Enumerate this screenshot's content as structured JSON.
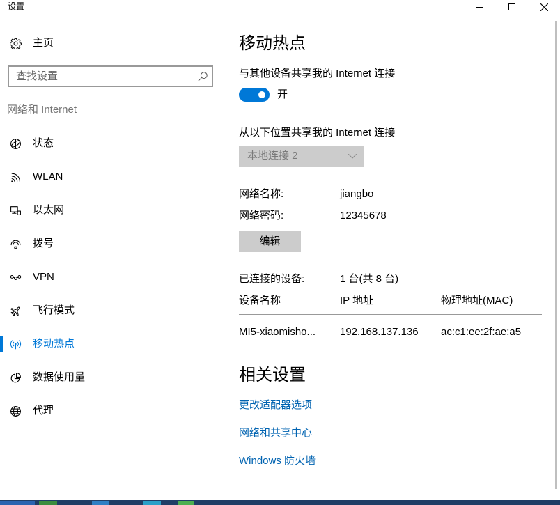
{
  "window": {
    "title": "设置",
    "controls": {
      "minimize_icon": "minimize-icon",
      "maximize_icon": "maximize-icon",
      "close_icon": "close-icon"
    }
  },
  "colors": {
    "accent": "#0078d7",
    "link": "#0063b1",
    "text": "#000000",
    "muted": "#767676",
    "disabled_fill": "#cccccc",
    "disabled_text": "#7a7a7a"
  },
  "sidebar": {
    "home": {
      "label": "主页",
      "icon": "gear-icon"
    },
    "search": {
      "placeholder": "查找设置",
      "value": "",
      "icon": "search-icon"
    },
    "section_title": "网络和 Internet",
    "items": [
      {
        "label": "状态",
        "icon": "network-status-icon",
        "selected": false
      },
      {
        "label": "WLAN",
        "icon": "wifi-icon",
        "selected": false
      },
      {
        "label": "以太网",
        "icon": "ethernet-icon",
        "selected": false
      },
      {
        "label": "拨号",
        "icon": "dial-up-icon",
        "selected": false
      },
      {
        "label": "VPN",
        "icon": "vpn-icon",
        "selected": false
      },
      {
        "label": "飞行模式",
        "icon": "airplane-icon",
        "selected": false
      },
      {
        "label": "移动热点",
        "icon": "mobile-hotspot-icon",
        "selected": true
      },
      {
        "label": "数据使用量",
        "icon": "data-usage-icon",
        "selected": false
      },
      {
        "label": "代理",
        "icon": "proxy-globe-icon",
        "selected": false
      }
    ]
  },
  "main": {
    "title": "移动热点",
    "share_label": "与其他设备共享我的 Internet 连接",
    "hotspot_toggle": {
      "on": true,
      "state_label": "开"
    },
    "share_from_label": "从以下位置共享我的 Internet 连接",
    "share_from_dropdown": {
      "selected": "本地连接 2",
      "disabled": true,
      "icon": "chevron-down-icon"
    },
    "network_name": {
      "label": "网络名称:",
      "value": "jiangbo"
    },
    "network_password": {
      "label": "网络密码:",
      "value": "12345678"
    },
    "edit_button_label": "编辑",
    "connected_devices": {
      "label": "已连接的设备:",
      "value": "1 台(共 8 台)"
    },
    "devices_table": {
      "headers": [
        "设备名称",
        "IP 地址",
        "物理地址(MAC)"
      ],
      "rows": [
        [
          "MI5-xiaomisho...",
          "192.168.137.136",
          "ac:c1:ee:2f:ae:a5"
        ]
      ]
    },
    "related_title": "相关设置",
    "related_links": [
      "更改适配器选项",
      "网络和共享中心",
      "Windows 防火墙"
    ]
  }
}
